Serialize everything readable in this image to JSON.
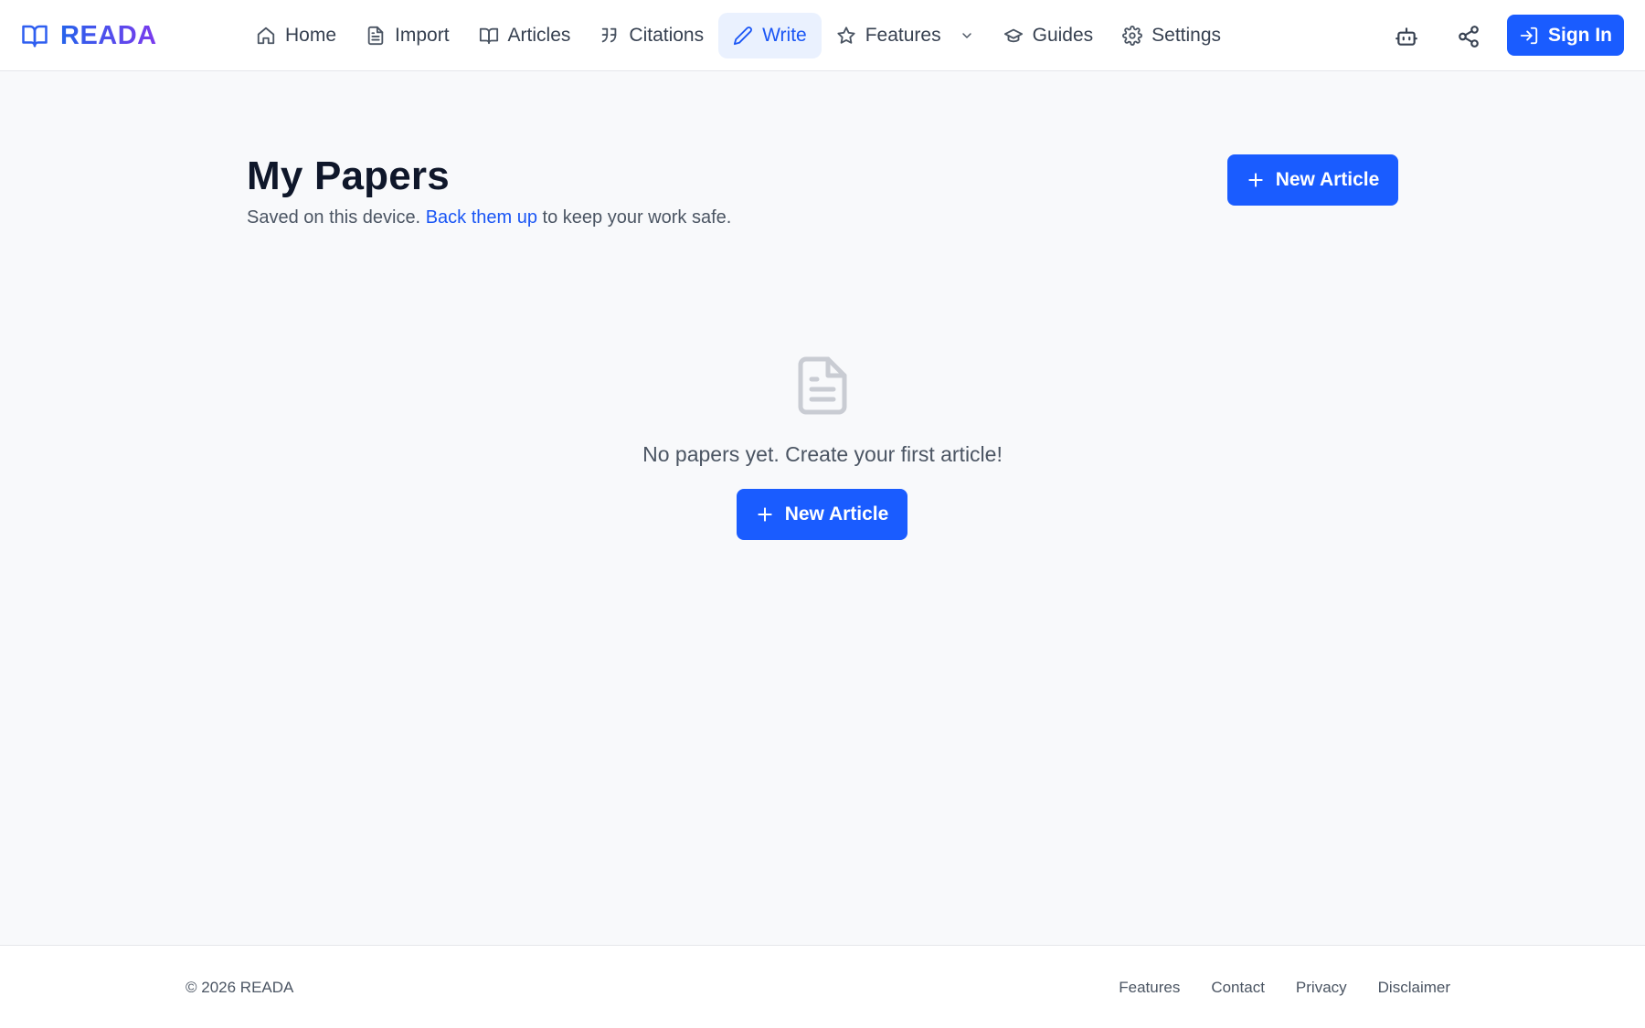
{
  "brand": {
    "name": "READA",
    "icon": "book-open-icon",
    "gradient": [
      "#2563eb",
      "#7c3aed"
    ]
  },
  "nav": {
    "items": [
      {
        "label": "Home",
        "icon": "home-icon"
      },
      {
        "label": "Import",
        "icon": "file-text-icon"
      },
      {
        "label": "Articles",
        "icon": "book-open-icon"
      },
      {
        "label": "Citations",
        "icon": "quote-icon"
      },
      {
        "label": "Write",
        "icon": "pencil-icon",
        "active": true
      },
      {
        "label": "Features",
        "icon": "star-icon",
        "has_dropdown": true
      },
      {
        "label": "Guides",
        "icon": "graduation-cap-icon"
      },
      {
        "label": "Settings",
        "icon": "gear-icon"
      }
    ],
    "actions": [
      {
        "name": "assistant",
        "icon": "bot-icon"
      },
      {
        "name": "share",
        "icon": "share-icon"
      }
    ],
    "sign_in_label": "Sign In"
  },
  "main": {
    "title": "My Papers",
    "subtitle_prefix": "Saved on this device.",
    "subtitle_link": "Back them up",
    "subtitle_suffix": "to keep your work safe.",
    "new_article_label": "New Article",
    "empty_state": {
      "icon": "document-icon",
      "message": "No papers yet. Create your first article!",
      "button_label": "New Article"
    }
  },
  "footer": {
    "copyright": "© 2026 READA",
    "links": [
      "Features",
      "Contact",
      "Privacy",
      "Disclaimer"
    ]
  },
  "colors": {
    "accent": "#1a5cff",
    "link": "#1a56f5",
    "active_nav_bg": "#eaf1fe",
    "page_bg": "#f8f9fb"
  }
}
